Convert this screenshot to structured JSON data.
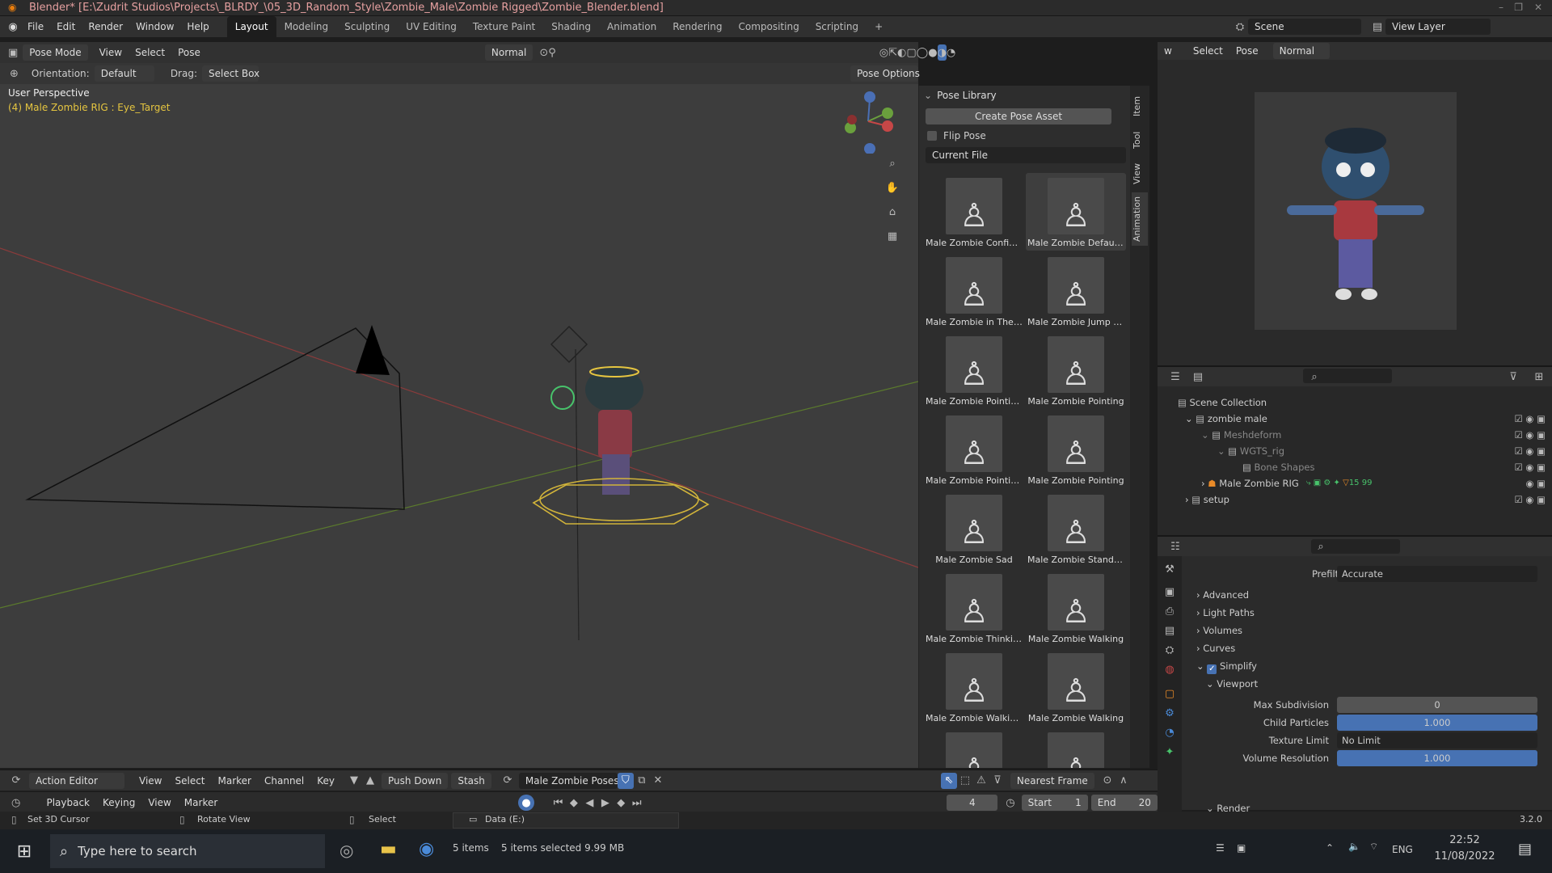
{
  "window": {
    "title": "Blender* [E:\\Zudrit Studios\\Projects\\_BLRDY_\\05_3D_Random_Style\\Zombie_Male\\Zombie Rigged\\Zombie_Blender.blend]"
  },
  "menu": [
    "File",
    "Edit",
    "Render",
    "Window",
    "Help"
  ],
  "workspaces": [
    "Layout",
    "Modeling",
    "Sculpting",
    "UV Editing",
    "Texture Paint",
    "Shading",
    "Animation",
    "Rendering",
    "Compositing",
    "Scripting",
    "+"
  ],
  "scene": {
    "name": "Scene",
    "view_layer": "View Layer"
  },
  "viewport": {
    "mode": "Pose Mode",
    "menus": [
      "View",
      "Select",
      "Pose"
    ],
    "shading": "Normal",
    "orientation_label": "Orientation:",
    "orientation": "Default",
    "drag_label": "Drag:",
    "drag": "Select Box",
    "pose_options": "Pose Options",
    "perspective": "User Perspective",
    "active": "(4) Male Zombie RIG : Eye_Target",
    "side_tabs": [
      "Item",
      "Tool",
      "View",
      "Animation"
    ]
  },
  "pose_library": {
    "title": "Pose Library",
    "create": "Create Pose Asset",
    "flip": "Flip Pose",
    "source": "Current File",
    "poses": [
      "Male Zombie Confiden",
      "Male Zombie Default ...",
      "Male Zombie in The ai",
      "Male Zombie Jump H...",
      "Male Zombie Pointin...",
      "Male Zombie Pointing",
      "Male Zombie Pointin...",
      "Male Zombie Pointing",
      "Male Zombie Sad",
      "Male Zombie Standin...",
      "Male Zombie Thinking",
      "Male Zombie Walking",
      "Male Zombie Walkin...",
      "Male Zombie Walking",
      "",
      ""
    ]
  },
  "right_header": {
    "menus": [
      "w",
      "Select",
      "Pose"
    ],
    "shading": "Normal"
  },
  "outliner": {
    "items": [
      {
        "label": "Scene Collection",
        "indent": 0
      },
      {
        "label": "zombie male",
        "indent": 1
      },
      {
        "label": "Meshdeform",
        "indent": 2
      },
      {
        "label": "WGTS_rig",
        "indent": 3
      },
      {
        "label": "Bone Shapes",
        "indent": 4
      },
      {
        "label": "Male Zombie RIG",
        "indent": 2
      },
      {
        "label": "setup",
        "indent": 1
      }
    ],
    "rig_badges": [
      "15",
      "99"
    ]
  },
  "properties": {
    "prefilter_label": "Prefilter",
    "prefilter": "Accurate",
    "sections": [
      "Advanced",
      "Light Paths",
      "Volumes",
      "Curves"
    ],
    "simplify": "Simplify",
    "viewport": "Viewport",
    "fields": [
      {
        "label": "Max Subdivision",
        "value": "0",
        "fill": 0
      },
      {
        "label": "Child Particles",
        "value": "1.000",
        "fill": 1
      },
      {
        "label": "Texture Limit",
        "value": "No Limit",
        "fill": 0
      },
      {
        "label": "Volume Resolution",
        "value": "1.000",
        "fill": 1
      }
    ],
    "render": "Render"
  },
  "action_editor": {
    "mode": "Action Editor",
    "menus": [
      "View",
      "Select",
      "Marker",
      "Channel",
      "Key"
    ],
    "push_down": "Push Down",
    "stash": "Stash",
    "action": "Male Zombie Poses",
    "snap": "Nearest Frame"
  },
  "playback": {
    "menus": [
      "Playback",
      "Keying",
      "View",
      "Marker"
    ],
    "frame": "4",
    "start_label": "Start",
    "start": "1",
    "end_label": "End",
    "end": "20"
  },
  "status": {
    "left": "Set 3D Cursor",
    "mid": "Rotate View",
    "right": "Select",
    "version": "3.2.0",
    "drive": "Data (E:)",
    "items": "5 items",
    "selected": "5 items selected  9.99 MB"
  },
  "taskbar": {
    "search": "Type here to search",
    "lang": "ENG",
    "time": "22:52",
    "date": "11/08/2022"
  }
}
